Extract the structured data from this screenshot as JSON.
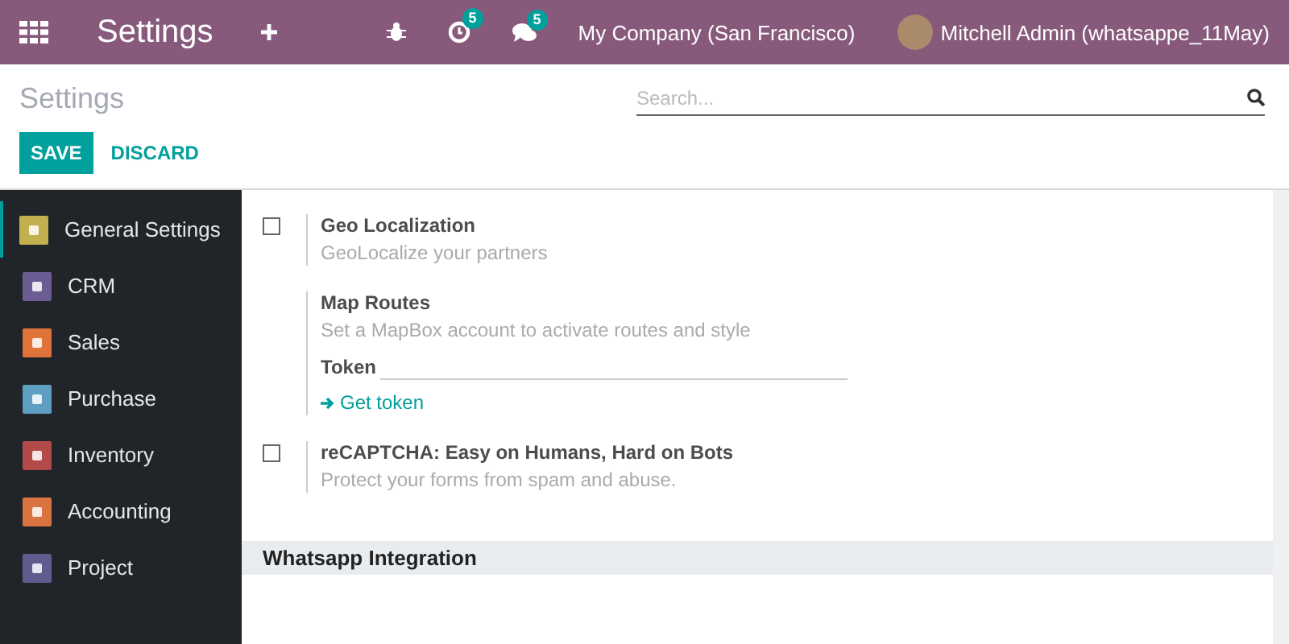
{
  "navbar": {
    "app_title": "Settings",
    "activity_count": "5",
    "message_count": "5",
    "company": "My Company (San Francisco)",
    "user": "Mitchell Admin (whatsappe_11May)"
  },
  "control_panel": {
    "breadcrumb": "Settings",
    "search": {
      "placeholder": "Search..."
    },
    "buttons": [
      {
        "label": "SAVE",
        "kind": "primary"
      },
      {
        "label": "DISCARD",
        "kind": "link"
      }
    ]
  },
  "sidebar": {
    "items": [
      {
        "label": "General Settings",
        "selected": true,
        "color": "#c2b04e"
      },
      {
        "label": "CRM",
        "selected": false,
        "color": "#6b5d93"
      },
      {
        "label": "Sales",
        "selected": false,
        "color": "#e0733a"
      },
      {
        "label": "Purchase",
        "selected": false,
        "color": "#5e9ec0"
      },
      {
        "label": "Inventory",
        "selected": false,
        "color": "#b34a4a"
      },
      {
        "label": "Accounting",
        "selected": false,
        "color": "#d9733f"
      },
      {
        "label": "Project",
        "selected": false,
        "color": "#5e5b8f"
      }
    ]
  },
  "settings": [
    {
      "kind": "checkbox",
      "title": "Geo Localization",
      "description": "GeoLocalize your partners",
      "checked": false
    },
    {
      "kind": "subsetting",
      "title": "Map Routes",
      "description": "Set a MapBox account to activate routes and style",
      "field_label": "Token",
      "link": "Get token"
    },
    {
      "kind": "checkbox",
      "title": "reCAPTCHA: Easy on Humans, Hard on Bots",
      "description": "Protect your forms from spam and abuse.",
      "checked": false
    }
  ],
  "section": {
    "title": "Whatsapp Integration"
  }
}
